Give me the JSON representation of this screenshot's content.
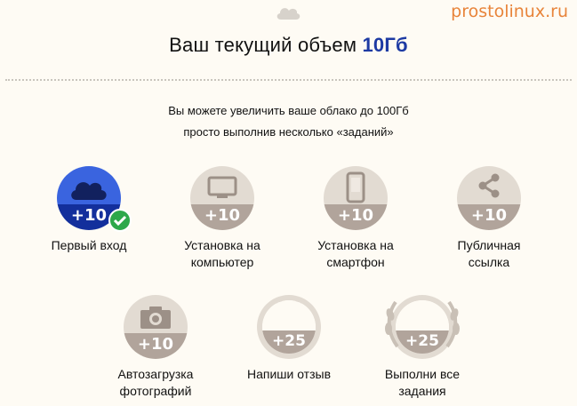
{
  "watermark": "prostolinux.ru",
  "header": {
    "title_prefix": "Ваш текущий объем",
    "title_volume": "10Гб",
    "subtitle_line1": "Вы можете увеличить ваше облако до 100Гб",
    "subtitle_line2": "просто выполнив несколько «заданий»"
  },
  "colors": {
    "accent_blue": "#1d3aa3",
    "badge_done": "#3a64df",
    "badge_pending": "#b1a49b",
    "check_green": "#2da84a",
    "watermark": "#e8843a"
  },
  "tasks": [
    {
      "points": "+10",
      "label_1": "Первый вход",
      "label_2": "",
      "icon": "cloud-icon",
      "done": true
    },
    {
      "points": "+10",
      "label_1": "Установка на",
      "label_2": "компьютер",
      "icon": "monitor-icon",
      "done": false
    },
    {
      "points": "+10",
      "label_1": "Установка на",
      "label_2": "смартфон",
      "icon": "smartphone-icon",
      "done": false
    },
    {
      "points": "+10",
      "label_1": "Публичная",
      "label_2": "ссылка",
      "icon": "share-icon",
      "done": false
    },
    {
      "points": "+10",
      "label_1": "Автозагрузка",
      "label_2": "фотографий",
      "icon": "camera-icon",
      "done": false
    },
    {
      "points": "+25",
      "label_1": "Напиши отзыв",
      "label_2": "",
      "icon": "envelope-icon",
      "done": false
    },
    {
      "points": "+25",
      "label_1": "Выполни все",
      "label_2": "задания",
      "icon": "trophy-icon",
      "done": false
    }
  ]
}
